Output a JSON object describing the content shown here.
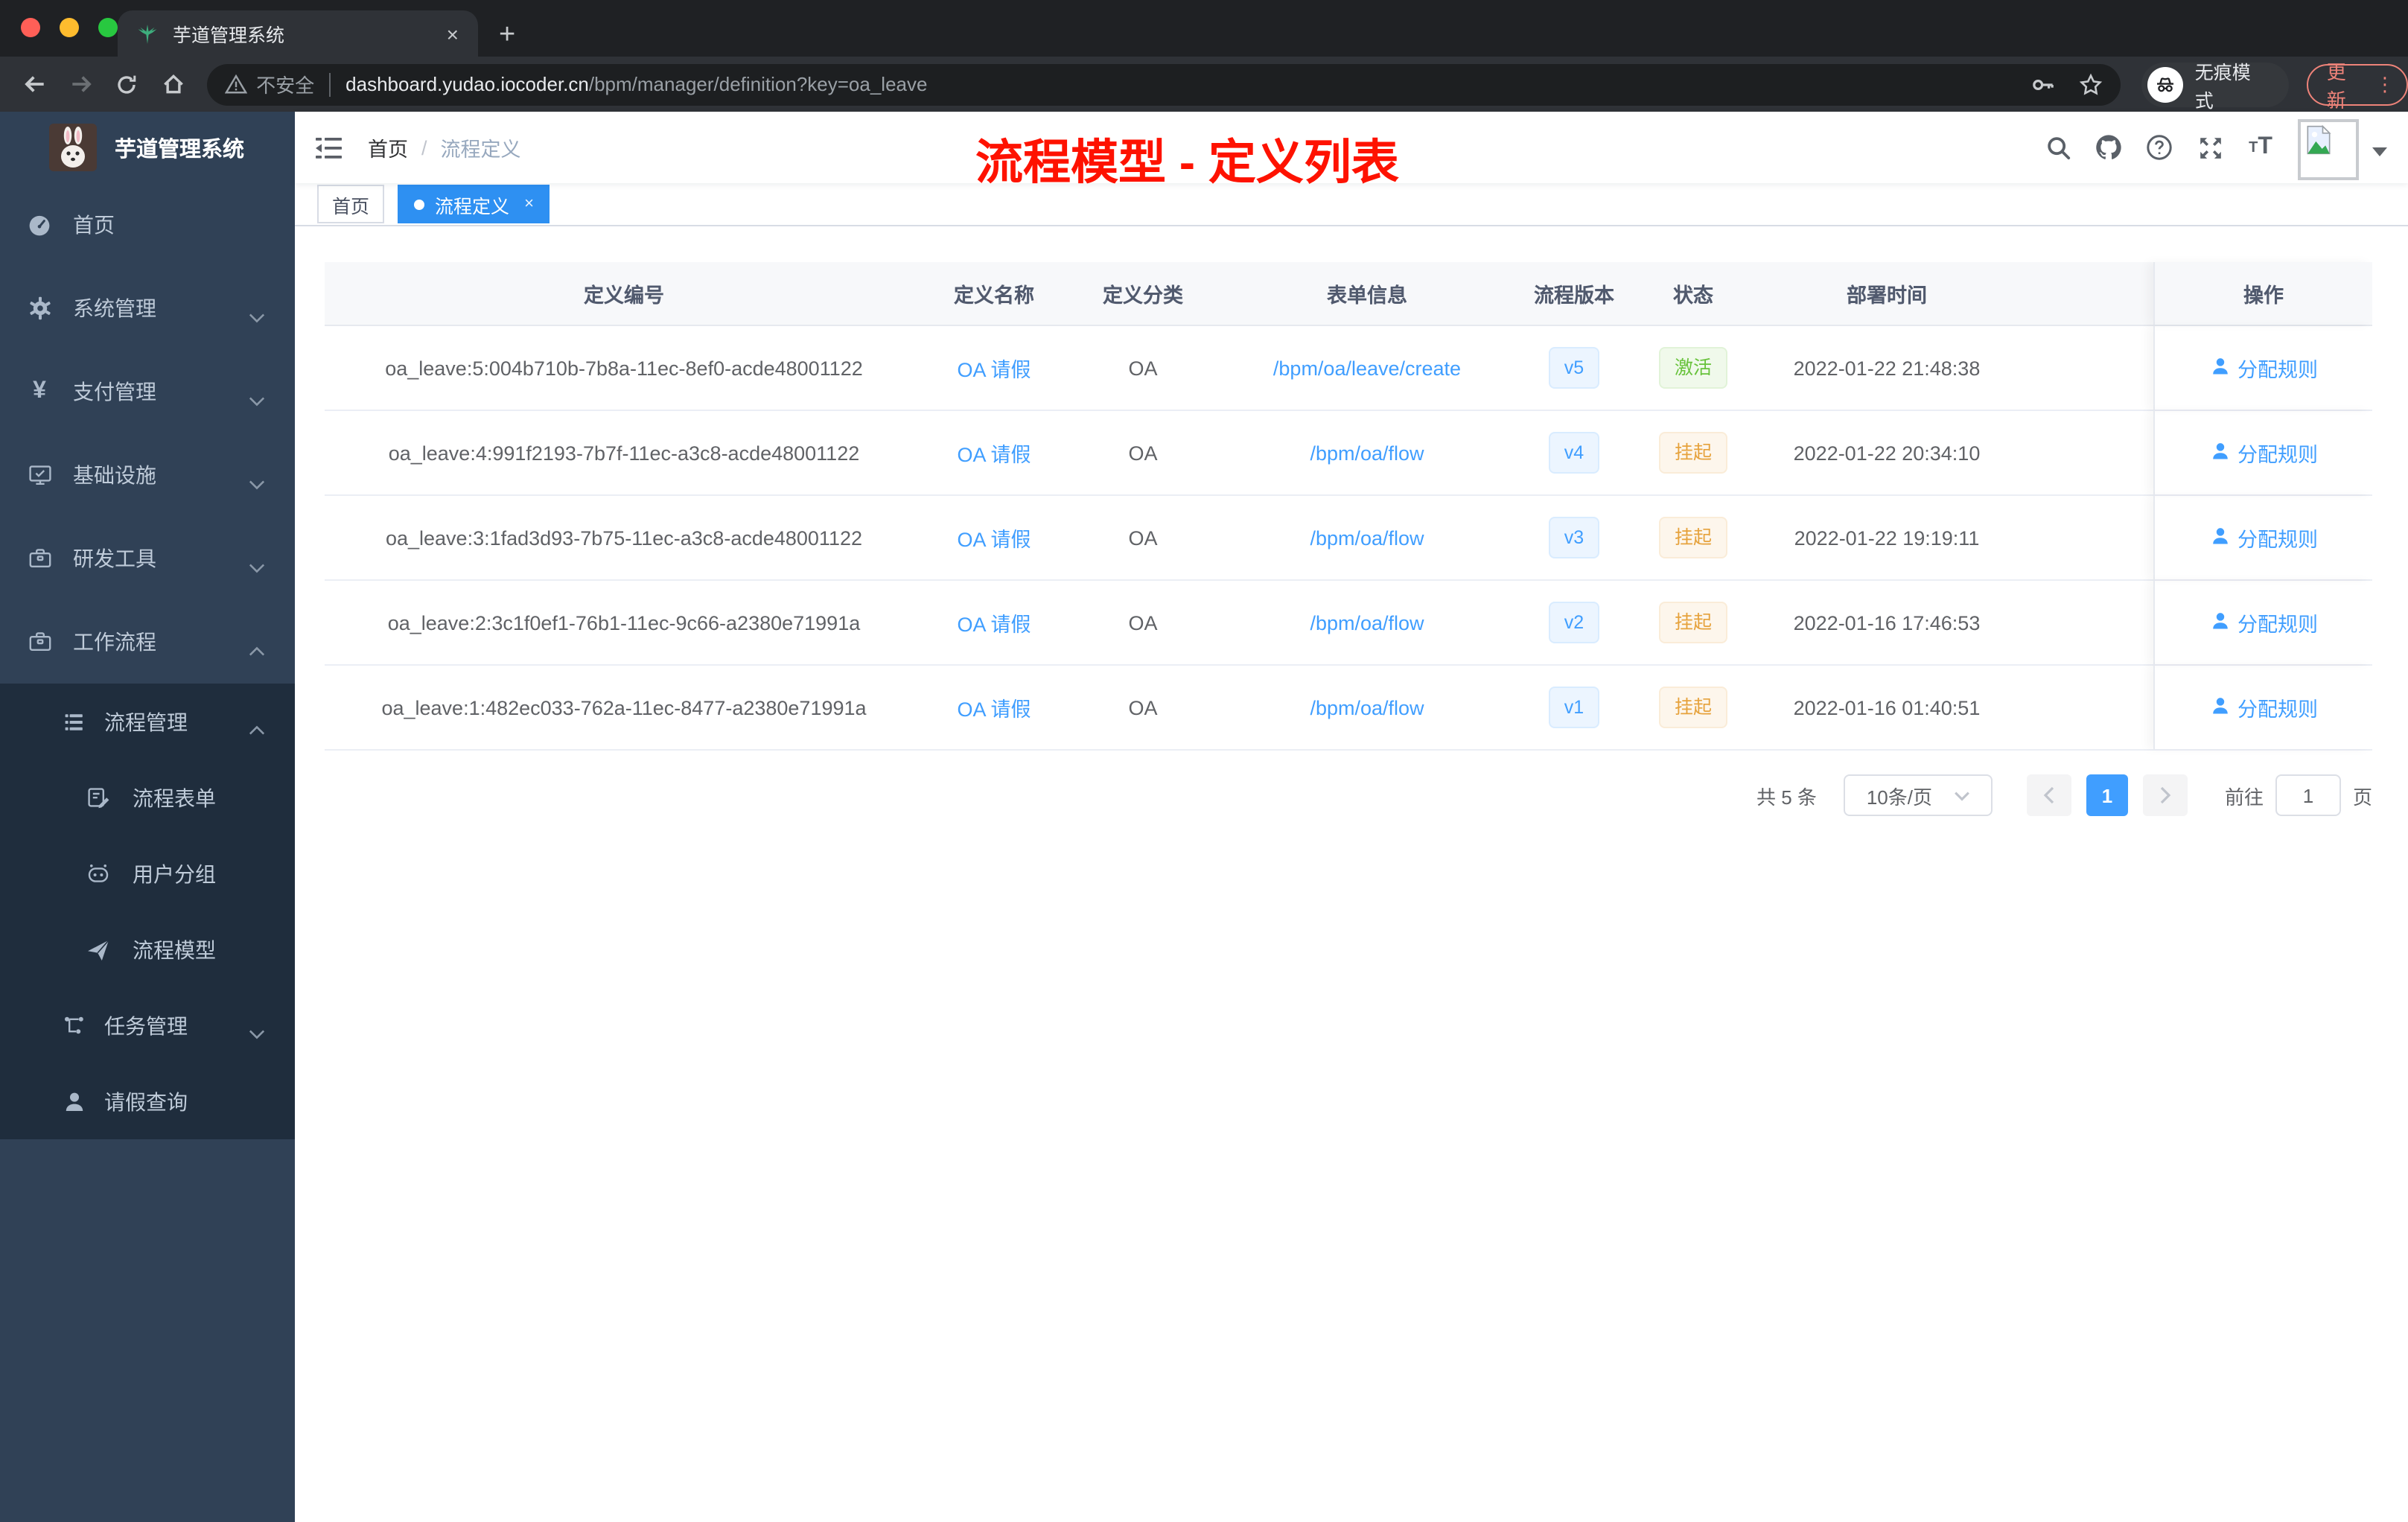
{
  "browser": {
    "tab_title": "芋道管理系统",
    "close_tab_glyph": "×",
    "new_tab_glyph": "+",
    "security_label": "不安全",
    "url_domain": "dashboard.yudao.iocoder.cn",
    "url_path": "/bpm/manager/definition?key=oa_leave",
    "incognito_label": "无痕模式",
    "update_label": "更新",
    "menu_dots": "⋮"
  },
  "sidebar": {
    "logo_title": "芋道管理系统",
    "items": [
      {
        "label": "首页",
        "icon": "dashboard-icon",
        "level": "top",
        "chevron": ""
      },
      {
        "label": "系统管理",
        "icon": "gear-icon",
        "level": "top",
        "chevron": "down"
      },
      {
        "label": "支付管理",
        "icon": "yen-icon",
        "level": "top",
        "chevron": "down"
      },
      {
        "label": "基础设施",
        "icon": "monitor-icon",
        "level": "top",
        "chevron": "down"
      },
      {
        "label": "研发工具",
        "icon": "briefcase-icon",
        "level": "top",
        "chevron": "down"
      },
      {
        "label": "工作流程",
        "icon": "briefcase-icon",
        "level": "top",
        "chevron": "up"
      },
      {
        "label": "流程管理",
        "icon": "list-icon",
        "level": "sub1",
        "chevron": "up"
      },
      {
        "label": "流程表单",
        "icon": "form-icon",
        "level": "sub2",
        "chevron": ""
      },
      {
        "label": "用户分组",
        "icon": "robot-icon",
        "level": "sub2",
        "chevron": ""
      },
      {
        "label": "流程模型",
        "icon": "send-icon",
        "level": "sub2",
        "chevron": ""
      },
      {
        "label": "任务管理",
        "icon": "tree-icon",
        "level": "sub1",
        "chevron": "down"
      },
      {
        "label": "请假查询",
        "icon": "user-icon",
        "level": "sub1",
        "chevron": ""
      }
    ]
  },
  "header": {
    "breadcrumb_home": "首页",
    "breadcrumb_sep": "/",
    "breadcrumb_current": "流程定义",
    "annotation": "流程模型 - 定义列表"
  },
  "tags": [
    {
      "label": "首页",
      "active": false
    },
    {
      "label": "流程定义",
      "active": true,
      "close_glyph": "×"
    }
  ],
  "table": {
    "columns": [
      "定义编号",
      "定义名称",
      "定义分类",
      "表单信息",
      "流程版本",
      "状态",
      "部署时间",
      "操作"
    ],
    "action_label": "分配规则",
    "rows": [
      {
        "id": "oa_leave:5:004b710b-7b8a-11ec-8ef0-acde48001122",
        "name": "OA 请假",
        "category": "OA",
        "form": "/bpm/oa/leave/create",
        "version": "v5",
        "status": "激活",
        "status_type": "success",
        "deployed": "2022-01-22 21:48:38"
      },
      {
        "id": "oa_leave:4:991f2193-7b7f-11ec-a3c8-acde48001122",
        "name": "OA 请假",
        "category": "OA",
        "form": "/bpm/oa/flow",
        "version": "v4",
        "status": "挂起",
        "status_type": "warning",
        "deployed": "2022-01-22 20:34:10"
      },
      {
        "id": "oa_leave:3:1fad3d93-7b75-11ec-a3c8-acde48001122",
        "name": "OA 请假",
        "category": "OA",
        "form": "/bpm/oa/flow",
        "version": "v3",
        "status": "挂起",
        "status_type": "warning",
        "deployed": "2022-01-22 19:19:11"
      },
      {
        "id": "oa_leave:2:3c1f0ef1-76b1-11ec-9c66-a2380e71991a",
        "name": "OA 请假",
        "category": "OA",
        "form": "/bpm/oa/flow",
        "version": "v2",
        "status": "挂起",
        "status_type": "warning",
        "deployed": "2022-01-16 17:46:53"
      },
      {
        "id": "oa_leave:1:482ec033-762a-11ec-8477-a2380e71991a",
        "name": "OA 请假",
        "category": "OA",
        "form": "/bpm/oa/flow",
        "version": "v1",
        "status": "挂起",
        "status_type": "warning",
        "deployed": "2022-01-16 01:40:51"
      }
    ]
  },
  "pagination": {
    "total_label": "共 5 条",
    "page_size": "10条/页",
    "current_page": "1",
    "goto_label": "前往",
    "goto_value": "1",
    "page_unit": "页"
  },
  "colors": {
    "accent_blue": "#409eff",
    "active_tag_blue": "#2e90f2",
    "success_green": "#67c23a",
    "warning_orange": "#e6a23c",
    "sidebar_bg": "#304156",
    "submenu_bg": "#1f2d3d",
    "annotation_red": "#fe1200"
  }
}
